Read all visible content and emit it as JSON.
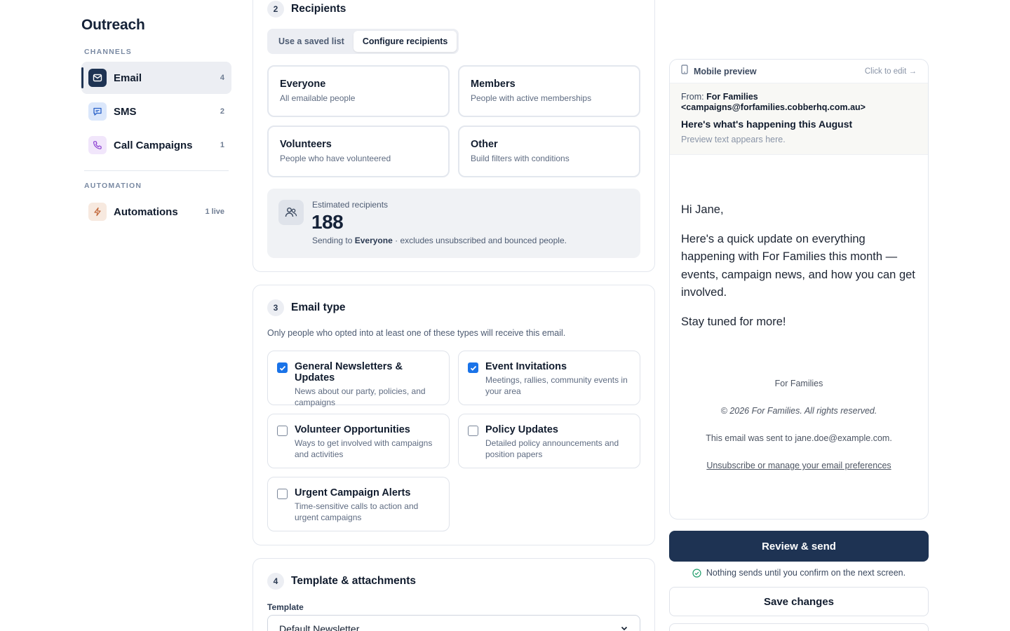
{
  "sidebar": {
    "brand": "Outreach",
    "channels_label": "CHANNELS",
    "automation_label": "AUTOMATION",
    "items": [
      {
        "label": "Email",
        "count": "4",
        "icon": "mail-icon",
        "color": "#1e3353"
      },
      {
        "label": "SMS",
        "count": "2",
        "icon": "message-icon",
        "color": "#dbe7fb"
      },
      {
        "label": "Call Campaigns",
        "count": "1",
        "icon": "phone-icon",
        "color": "#f1e6fb"
      },
      {
        "label": "Automations",
        "count": "1 live",
        "icon": "bolt-icon",
        "color": "#f7e9df"
      }
    ]
  },
  "recipients": {
    "step": "2",
    "title": "Recipients",
    "tabs": [
      "Use a saved list",
      "Configure recipients"
    ],
    "active_tab": "Configure recipients",
    "options": [
      {
        "title": "Everyone",
        "desc": "All emailable people"
      },
      {
        "title": "Members",
        "desc": "People with active memberships"
      },
      {
        "title": "Volunteers",
        "desc": "People who have volunteered"
      },
      {
        "title": "Other",
        "desc": "Build filters with conditions"
      }
    ],
    "estimate": {
      "label": "Estimated recipients",
      "count": "188",
      "note_prefix": "Sending to",
      "note_target": "Everyone",
      "note_suffix": "· excludes unsubscribed and bounced people."
    }
  },
  "email_type": {
    "step": "3",
    "title": "Email type",
    "desc": "Only people who opted into at least one of these types will receive this email.",
    "types": [
      {
        "title": "General Newsletters & Updates",
        "desc": "News about our party, policies, and campaigns",
        "checked": true
      },
      {
        "title": "Event Invitations",
        "desc": "Meetings, rallies, community events in your area",
        "checked": true
      },
      {
        "title": "Volunteer Opportunities",
        "desc": "Ways to get involved with campaigns and activities",
        "checked": false
      },
      {
        "title": "Policy Updates",
        "desc": "Detailed policy announcements and position papers",
        "checked": false
      },
      {
        "title": "Urgent Campaign Alerts",
        "desc": "Time-sensitive calls to action and urgent campaigns",
        "checked": false
      }
    ]
  },
  "template": {
    "step": "4",
    "title": "Template & attachments",
    "label": "Template",
    "selected": "Default Newsletter"
  },
  "preview": {
    "title": "Mobile preview",
    "edit_hint": "Click to edit →",
    "from_label": "From:",
    "from_name": "For Families",
    "from_email": "<campaigns@forfamilies.cobberhq.com.au>",
    "subject": "Here's what's happening this August",
    "preview_text": "Preview text appears here.",
    "greeting": "Hi Jane,",
    "body": "Here's a quick update on everything happening with For Families this month — events, campaign news, and how you can get involved.",
    "closing": "Stay tuned for more!",
    "footer_org": "For Families",
    "footer_copyright": "© 2026 For Families. All rights reserved.",
    "footer_sent": "This email was sent to jane.doe@example.com.",
    "footer_unsub": "Unsubscribe or manage your email preferences"
  },
  "actions": {
    "review_send": "Review & send",
    "confirm_note": "Nothing sends until you confirm on the next screen.",
    "save_changes": "Save changes"
  }
}
